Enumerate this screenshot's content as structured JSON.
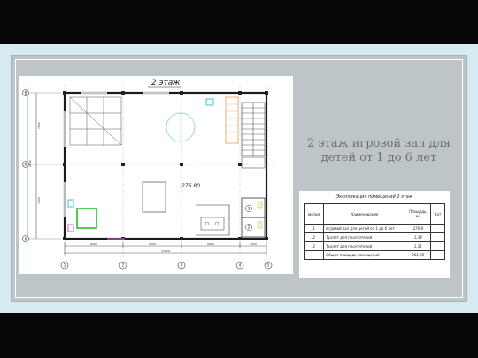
{
  "slide": {
    "title_line1": "2 этаж игровой зал для",
    "title_line2": "детей от 1 до 6 лет"
  },
  "floor_plan": {
    "floor_label": "2 этаж",
    "area_label": "276.80",
    "axis_rows": [
      "В",
      "Б",
      "А"
    ],
    "axis_cols": [
      "1",
      "2",
      "3",
      "4",
      "5"
    ],
    "room_numbers": [
      "3",
      "2"
    ],
    "dim_left": [
      "7000",
      "6000",
      "7000"
    ],
    "dim_bottom": [
      "6000",
      "6000",
      "6000",
      "3000"
    ],
    "dim_total": "21000",
    "colors": {
      "accent_cyan": "#37c6dc",
      "accent_magenta": "#d24fd2",
      "accent_green": "#24c024",
      "stair_orange": "#e8b070"
    }
  },
  "explication": {
    "caption": "Экспликация помещений 2 этаж",
    "headers": [
      "№ пом",
      "Наименование",
      "Площадь, м2",
      "Кат"
    ],
    "rows": [
      [
        "1",
        "Игровой зал для детей от 1 до 6 лет",
        "276,8",
        ""
      ],
      [
        "2",
        "Туалет для посетителей",
        "1,38",
        ""
      ],
      [
        "3",
        "Туалет для посетителей",
        "1,31",
        ""
      ],
      [
        "",
        "Общая площадь помещений",
        "281,90",
        ""
      ]
    ]
  }
}
